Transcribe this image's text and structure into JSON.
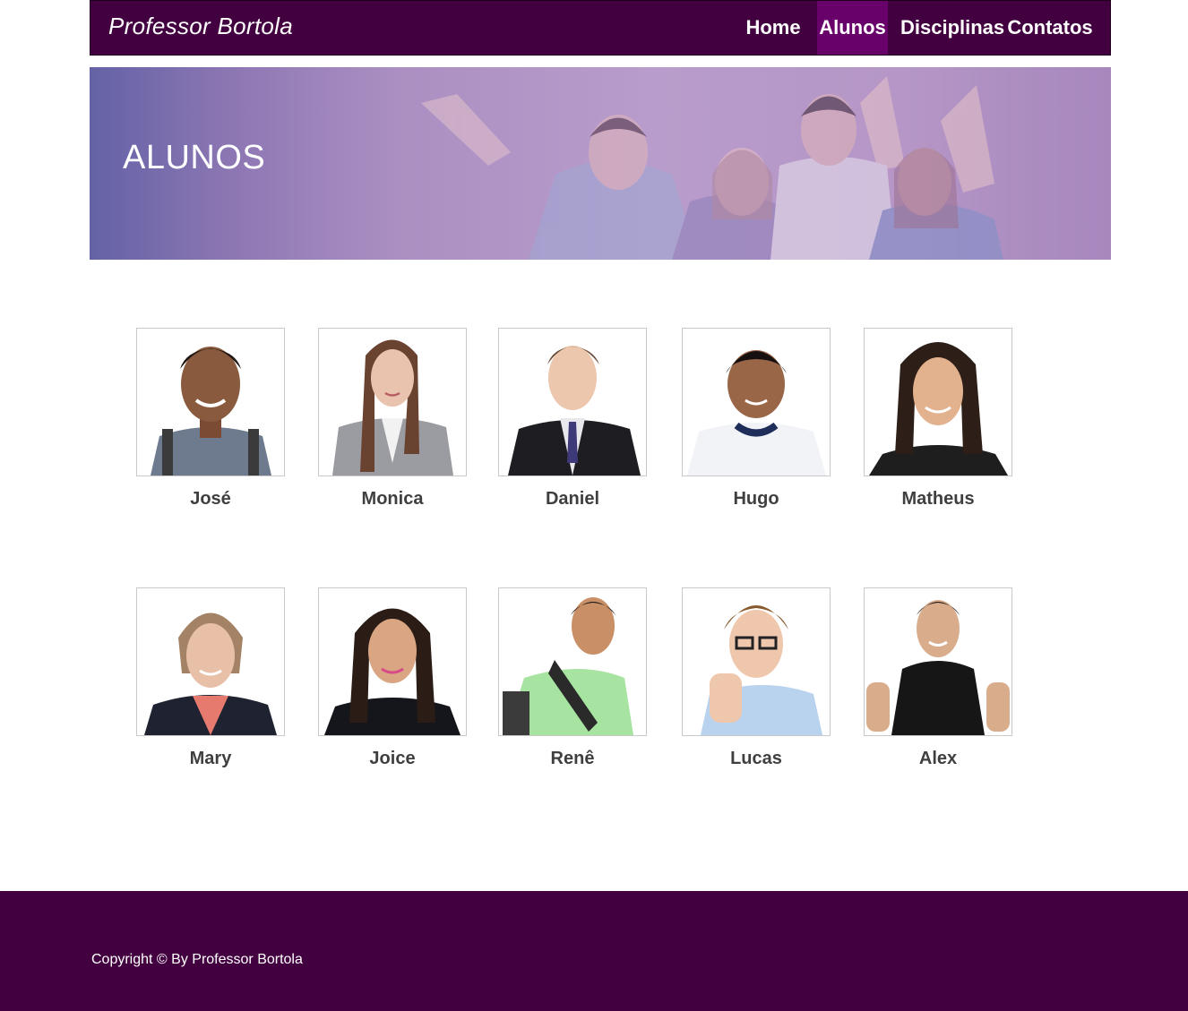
{
  "header": {
    "brand": "Professor Bortola",
    "nav": [
      {
        "label": "Home",
        "active": false
      },
      {
        "label": "Alunos",
        "active": true
      },
      {
        "label": "Disciplinas",
        "active": false
      },
      {
        "label": "Contatos",
        "active": false
      }
    ]
  },
  "hero": {
    "title": "ALUNOS"
  },
  "students": [
    {
      "name": "José"
    },
    {
      "name": "Monica"
    },
    {
      "name": "Daniel"
    },
    {
      "name": "Hugo"
    },
    {
      "name": "Matheus"
    },
    {
      "name": "Mary"
    },
    {
      "name": "Joice"
    },
    {
      "name": "Renê"
    },
    {
      "name": "Lucas"
    },
    {
      "name": "Alex"
    }
  ],
  "footer": {
    "copyright": "Copyright © By Professor Bortola"
  },
  "colors": {
    "brand_purple": "#420040",
    "active_tab": "#68016a",
    "name_text": "#3f3f3f"
  }
}
